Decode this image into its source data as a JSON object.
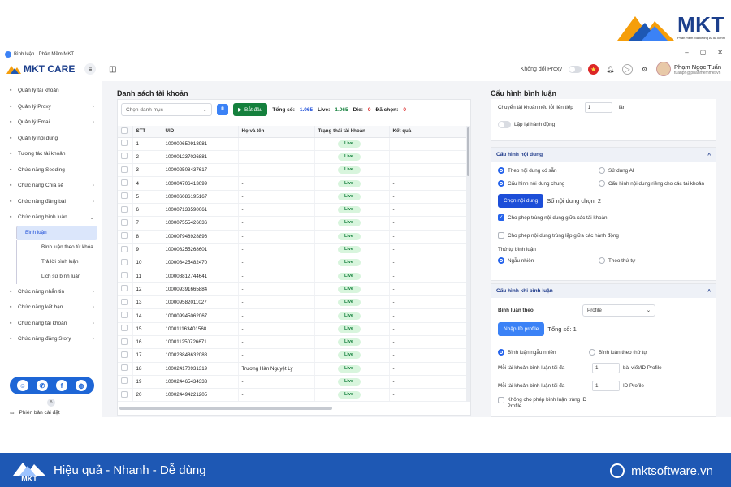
{
  "brand": {
    "name": "MKT",
    "tagline": "Phần mềm Marketing AI đa kênh"
  },
  "window": {
    "title": "Bình luận - Phần Mềm MKT",
    "min": "–",
    "max": "▢",
    "close": "✕"
  },
  "app": {
    "logo_text": "MKT CARE",
    "proxy_label": "Không đổi Proxy"
  },
  "user": {
    "name": "Phạm Ngọc Tuấn",
    "email": "tuanpn@phanmemmkt.vn"
  },
  "sidebar": {
    "items": [
      {
        "label": "Quản lý tài khoản",
        "icon": "grid-icon",
        "chev": ""
      },
      {
        "label": "Quản lý Proxy",
        "icon": "proxy-icon",
        "chev": "›"
      },
      {
        "label": "Quản lý Email",
        "icon": "mail-icon",
        "chev": "›"
      },
      {
        "label": "Quản lý nội dung",
        "icon": "content-icon",
        "chev": ""
      },
      {
        "label": "Tương tác tài khoản",
        "icon": "interact-icon",
        "chev": ""
      },
      {
        "label": "Chức năng Seeding",
        "icon": "seeding-icon",
        "chev": ""
      },
      {
        "label": "Chức năng Chia sẻ",
        "icon": "share-icon",
        "chev": "›"
      },
      {
        "label": "Chức năng đăng bài",
        "icon": "post-icon",
        "chev": "›"
      },
      {
        "label": "Chức năng bình luận",
        "icon": "comment-icon",
        "chev": "⌄"
      }
    ],
    "sub_items": [
      {
        "label": "Bình luận",
        "active": true
      },
      {
        "label": "Bình luận theo từ khóa",
        "active": false
      },
      {
        "label": "Trả lời bình luận",
        "active": false
      },
      {
        "label": "Lịch sử bình luận",
        "active": false
      }
    ],
    "items_after": [
      {
        "label": "Chức năng nhắn tin",
        "icon": "message-icon",
        "chev": "›"
      },
      {
        "label": "Chức năng kết bạn",
        "icon": "friend-icon",
        "chev": "›"
      },
      {
        "label": "Chức năng tài khoản",
        "icon": "account-icon",
        "chev": "›"
      },
      {
        "label": "Chức năng đăng Story",
        "icon": "story-icon",
        "chev": "›"
      }
    ],
    "version_label": "Phiên bản cài đặt"
  },
  "accounts": {
    "title": "Danh sách tài khoản",
    "select_placeholder": "Chọn danh mục",
    "start_label": "Bắt đầu",
    "total_label": "Tổng số:",
    "total_value": "1.065",
    "live_label": "Live:",
    "live_value": "1.065",
    "die_label": "Die:",
    "die_value": "0",
    "selected_label": "Đã chọn:",
    "selected_value": "0",
    "columns": [
      "STT",
      "UID",
      "Họ và tên",
      "Trạng thái tài khoản",
      "Kết quả"
    ],
    "rows": [
      [
        "1",
        "100000650918981",
        "-",
        "Live",
        "-"
      ],
      [
        "2",
        "100001237026881",
        "-",
        "Live",
        "-"
      ],
      [
        "3",
        "100002508437617",
        "-",
        "Live",
        "-"
      ],
      [
        "4",
        "100004706413099",
        "-",
        "Live",
        "-"
      ],
      [
        "5",
        "100006086195167",
        "-",
        "Live",
        "-"
      ],
      [
        "6",
        "100007133590061",
        "-",
        "Live",
        "-"
      ],
      [
        "7",
        "100007555426036",
        "-",
        "Live",
        "-"
      ],
      [
        "8",
        "100007948928896",
        "-",
        "Live",
        "-"
      ],
      [
        "9",
        "100008255268601",
        "-",
        "Live",
        "-"
      ],
      [
        "10",
        "100008425482470",
        "-",
        "Live",
        "-"
      ],
      [
        "11",
        "100008812744641",
        "-",
        "Live",
        "-"
      ],
      [
        "12",
        "100009391665884",
        "-",
        "Live",
        "-"
      ],
      [
        "13",
        "100009582011027",
        "-",
        "Live",
        "-"
      ],
      [
        "14",
        "100009945062067",
        "-",
        "Live",
        "-"
      ],
      [
        "15",
        "100011163401568",
        "-",
        "Live",
        "-"
      ],
      [
        "16",
        "100011250726671",
        "-",
        "Live",
        "-"
      ],
      [
        "17",
        "100023848632088",
        "-",
        "Live",
        "-"
      ],
      [
        "18",
        "100024170931319",
        "Trương Hàn Nguyệt Ly",
        "Live",
        "-"
      ],
      [
        "19",
        "100024465434333",
        "-",
        "Live",
        "-"
      ],
      [
        "20",
        "100024494221205",
        "-",
        "Live",
        "-"
      ]
    ]
  },
  "config": {
    "title": "Cấu hình bình luận",
    "switch_label": "Chuyển tài khoản nếu lỗi liên tiếp",
    "switch_value": "1",
    "switch_unit": "lần",
    "repeat_label": "Lặp lại hành động",
    "content_section": {
      "title": "Cấu hình nội dung",
      "opt_available": "Theo nội dung có sẵn",
      "opt_ai": "Sử dụng AI",
      "opt_shared": "Cấu hình nội dung chung",
      "opt_separate": "Cấu hình nội dung riêng cho các tài khoản",
      "choose_btn": "Chọn nội dung",
      "chosen_count": "Số nội dung chọn: 2",
      "allow_dup_accounts": "Cho phép trùng nội dung giữa các tài khoản",
      "allow_dup_actions": "Cho phép nội dung trùng lặp giữa các hành động",
      "order_label": "Thứ tự bình luận",
      "order_random": "Ngẫu nhiên",
      "order_sequential": "Theo thứ tự"
    },
    "comment_section": {
      "title": "Cấu hình khi bình luận",
      "comment_by_label": "Bình luận theo",
      "comment_by_value": "Profile",
      "import_btn": "Nhập ID profile",
      "total": "Tổng số: 1",
      "random_label": "Bình luận ngẫu nhiên",
      "sequential_label": "Bình luận theo thứ tự",
      "max_per_post_label": "Mỗi tài khoản bình luận tối đa",
      "max_per_post_value": "1",
      "max_per_post_unit": "bài viết/ID Profile",
      "max_per_profile_label": "Mỗi tài khoản bình luận tối đa",
      "max_per_profile_value": "1",
      "max_per_profile_unit": "ID Profile",
      "no_dup_label": "Không cho phép bình luận trùng ID Profile"
    }
  },
  "footer": {
    "logo_text": "MKT",
    "tagline": "Hiệu quả - Nhanh - Dễ dùng",
    "site": "mktsoftware.vn"
  },
  "colors": {
    "primary": "#1d4ed8",
    "success": "#15803d",
    "footer": "#1e58b4"
  }
}
